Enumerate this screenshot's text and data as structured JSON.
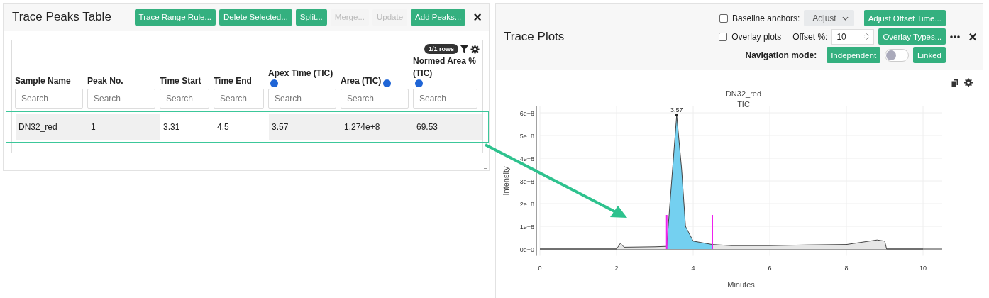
{
  "peaks_panel": {
    "title": "Trace Peaks Table",
    "buttons": [
      {
        "label": "Trace Range Rule...",
        "disabled": false
      },
      {
        "label": "Delete Selected...",
        "disabled": false
      },
      {
        "label": "Split...",
        "disabled": false
      },
      {
        "label": "Merge...",
        "disabled": true
      },
      {
        "label": "Update",
        "disabled": true
      },
      {
        "label": "Add Peaks...",
        "disabled": false
      }
    ],
    "close": "×",
    "table": {
      "row_count": "1/1 rows",
      "columns": [
        {
          "label": "Sample Name",
          "help": false,
          "editable": false,
          "placeholder": "Search"
        },
        {
          "label": "Peak No.",
          "help": false,
          "editable": false,
          "placeholder": "Search"
        },
        {
          "label": "Time Start",
          "help": false,
          "editable": true,
          "placeholder": "Search"
        },
        {
          "label": "Time End",
          "help": false,
          "editable": true,
          "placeholder": "Search"
        },
        {
          "label": "Apex Time (TIC)",
          "help": true,
          "editable": false,
          "placeholder": "Search"
        },
        {
          "label": "Area (TIC)",
          "help": true,
          "editable": false,
          "placeholder": "Search"
        },
        {
          "label": "Normed Area % (TIC)",
          "help": true,
          "editable": false,
          "placeholder": "Search"
        }
      ],
      "rows": [
        {
          "selected": true,
          "cells": [
            "DN32_red",
            "1",
            "3.31",
            "4.5",
            "3.57",
            "1.274e+8",
            "69.53"
          ]
        }
      ]
    }
  },
  "plots_panel": {
    "title": "Trace Plots",
    "baseline_anchors": {
      "label": "Baseline anchors:",
      "checked": false,
      "select": "Adjust"
    },
    "adjust_offset_button": "Adjust Offset Time...",
    "overlay_plots": {
      "label": "Overlay plots",
      "checked": false
    },
    "offset": {
      "label": "Offset %:",
      "value": "10"
    },
    "overlay_types_button": "Overlay Types...",
    "close": "×",
    "navigation": {
      "label": "Navigation mode:",
      "left": "Independent",
      "right": "Linked",
      "on": false
    },
    "chart_data": {
      "type": "area",
      "title": "DN32_red",
      "xlabel": "Minutes",
      "ylabel": "Intensity",
      "grid": true,
      "x": [
        0,
        2,
        2.1,
        2.2,
        3.0,
        3.31,
        3.57,
        3.7,
        3.8,
        4.0,
        4.5,
        5,
        6,
        7,
        8,
        8.6,
        8.8,
        9.0,
        9.05,
        10
      ],
      "series": [
        {
          "name": "TIC",
          "color": "#e6e6e6",
          "values": [
            0,
            0,
            25000000,
            8000000,
            10000000,
            12000000,
            590000000,
            350000000,
            100000000,
            35000000,
            20000000,
            15000000,
            15000000,
            18000000,
            20000000,
            35000000,
            40000000,
            35000000,
            0,
            0
          ]
        }
      ],
      "xlim": [
        0,
        10.5
      ],
      "ylim": [
        -30000000,
        630000000
      ],
      "xticks": [
        0,
        2,
        4,
        6,
        8,
        10
      ],
      "yticks": [
        {
          "value": 0,
          "label": "0e+0"
        },
        {
          "value": 100000000,
          "label": "1e+8"
        },
        {
          "value": 200000000,
          "label": "2e+8"
        },
        {
          "value": 300000000,
          "label": "3e+8"
        },
        {
          "value": 400000000,
          "label": "4e+8"
        },
        {
          "value": 500000000,
          "label": "5e+8"
        },
        {
          "value": 600000000,
          "label": "6e+8"
        }
      ],
      "annotations": [
        {
          "x": 3.57,
          "y": 590000000,
          "text": "3.57"
        }
      ],
      "ref_lines": [
        {
          "axis": "x",
          "value": 3.31,
          "color": "#ee22ee"
        },
        {
          "axis": "x",
          "value": 4.5,
          "color": "#ee22ee"
        }
      ]
    }
  }
}
